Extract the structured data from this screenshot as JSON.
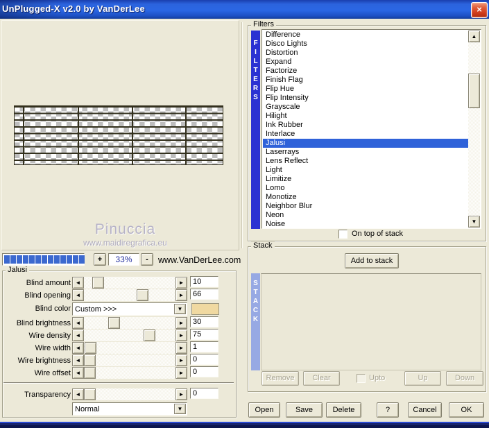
{
  "window": {
    "title": "UnPlugged-X v2.0 by VanDerLee",
    "close_glyph": "×"
  },
  "preview": {
    "watermark_title": "Pinuccia",
    "watermark_url": "www.maidiregrafica.eu"
  },
  "zoom_bar": {
    "segments": 13,
    "plus_label": "+",
    "zoom_value": "33%",
    "minus_label": "-",
    "site_label": "www.VanDerLee.com"
  },
  "jalusi": {
    "group_label": "Jalusi",
    "rows": [
      {
        "type": "slider",
        "label": "Blind amount",
        "value": 10
      },
      {
        "type": "slider",
        "label": "Blind opening",
        "value": 66
      },
      {
        "type": "color",
        "label": "Blind color",
        "selected": "Custom >>>",
        "swatch_color": "#f0d9a1"
      },
      {
        "type": "slider",
        "label": "Blind brightness",
        "value": 30
      },
      {
        "type": "slider",
        "label": "Wire density",
        "value": 75
      },
      {
        "type": "slider",
        "label": "Wire width",
        "value": 1
      },
      {
        "type": "slider",
        "label": "Wire brightness",
        "value": 0
      },
      {
        "type": "slider",
        "label": "Wire offset",
        "value": 0
      },
      {
        "type": "separator"
      },
      {
        "type": "slider",
        "label": "Transparency",
        "value": 0
      },
      {
        "type": "dropdown",
        "value": "Normal"
      }
    ]
  },
  "filters": {
    "group_label": "Filters",
    "sidebar_letters": [
      "F",
      "I",
      "L",
      "T",
      "E",
      "R",
      "S"
    ],
    "items": [
      "Difference",
      "Disco Lights",
      "Distortion",
      "Expand",
      "Factorize",
      "Finish Flag",
      "Flip Hue",
      "Flip Intensity",
      "Grayscale",
      "Hilight",
      "Ink Rubber",
      "Interlace",
      "Jalusi",
      "Laserrays",
      "Lens Reflect",
      "Light",
      "Limitize",
      "Lomo",
      "Monotize",
      "Neighbor Blur",
      "Neon",
      "Noise"
    ],
    "selected_item": "Jalusi",
    "on_top_label": "On top of stack"
  },
  "stack": {
    "group_label": "Stack",
    "add_button_label": "Add to stack",
    "sidebar_letters": [
      "S",
      "T",
      "A",
      "C",
      "K"
    ],
    "action_buttons": [
      {
        "label": "Remove",
        "enabled": false
      },
      {
        "label": "Clear",
        "enabled": false
      }
    ],
    "upto_label": "Upto",
    "move_buttons": [
      {
        "label": "Up",
        "enabled": false
      },
      {
        "label": "Down",
        "enabled": false
      }
    ]
  },
  "footer_buttons": [
    "Open",
    "Save",
    "Delete",
    "?",
    "Cancel",
    "OK"
  ],
  "colors": {
    "dialog_bg": "#ece9d8",
    "filters_bar": "#2b32d2",
    "stack_bar": "#97a9e3",
    "selection": "#2f62d9",
    "progress_segment": "#3c69cf",
    "swatch": "#f0d9a1",
    "title_blue": "#2b63dd"
  }
}
